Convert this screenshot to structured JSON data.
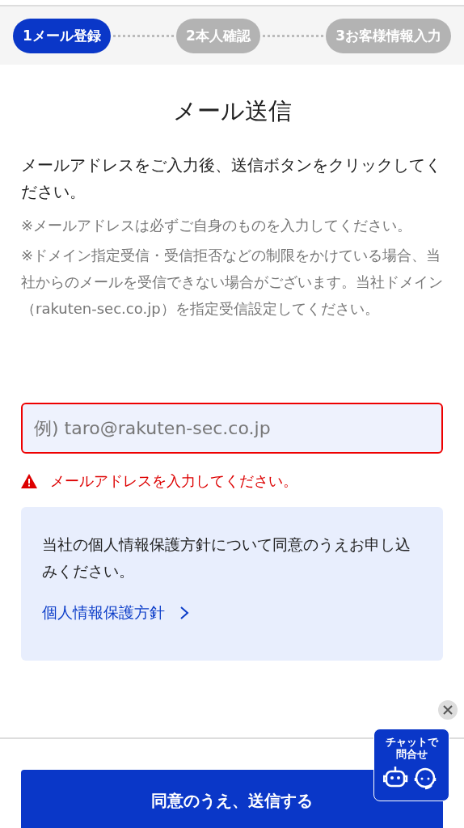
{
  "steps": [
    {
      "number": "1",
      "label": "メール登録",
      "selected": true
    },
    {
      "number": "2",
      "label": "本人確認",
      "selected": false
    },
    {
      "number": "3",
      "label": "お客様情報入力",
      "selected": false
    }
  ],
  "title": "メール送信",
  "lead": "メールアドレスをご入力後、送信ボタンをクリックしてください。",
  "notes": [
    "※メールアドレスは必ずご自身のものを入力してください。",
    "※ドメイン指定受信・受信拒否などの制限をかけている場合、当社からのメールを受信できない場合がございます。当社ドメイン（rakuten-sec.co.jp）を指定受信設定してください。"
  ],
  "email_field": {
    "placeholder": "例) taro@rakuten-sec.co.jp",
    "error": true
  },
  "error_message": "メールアドレスを入力してください。",
  "privacy": {
    "text": "当社の個人情報保護方針について同意のうえお申し込みください。",
    "link": "個人情報保護方針"
  },
  "submit_button": "同意のうえ、送信する",
  "chat": {
    "label": "チャットで問合せ"
  }
}
